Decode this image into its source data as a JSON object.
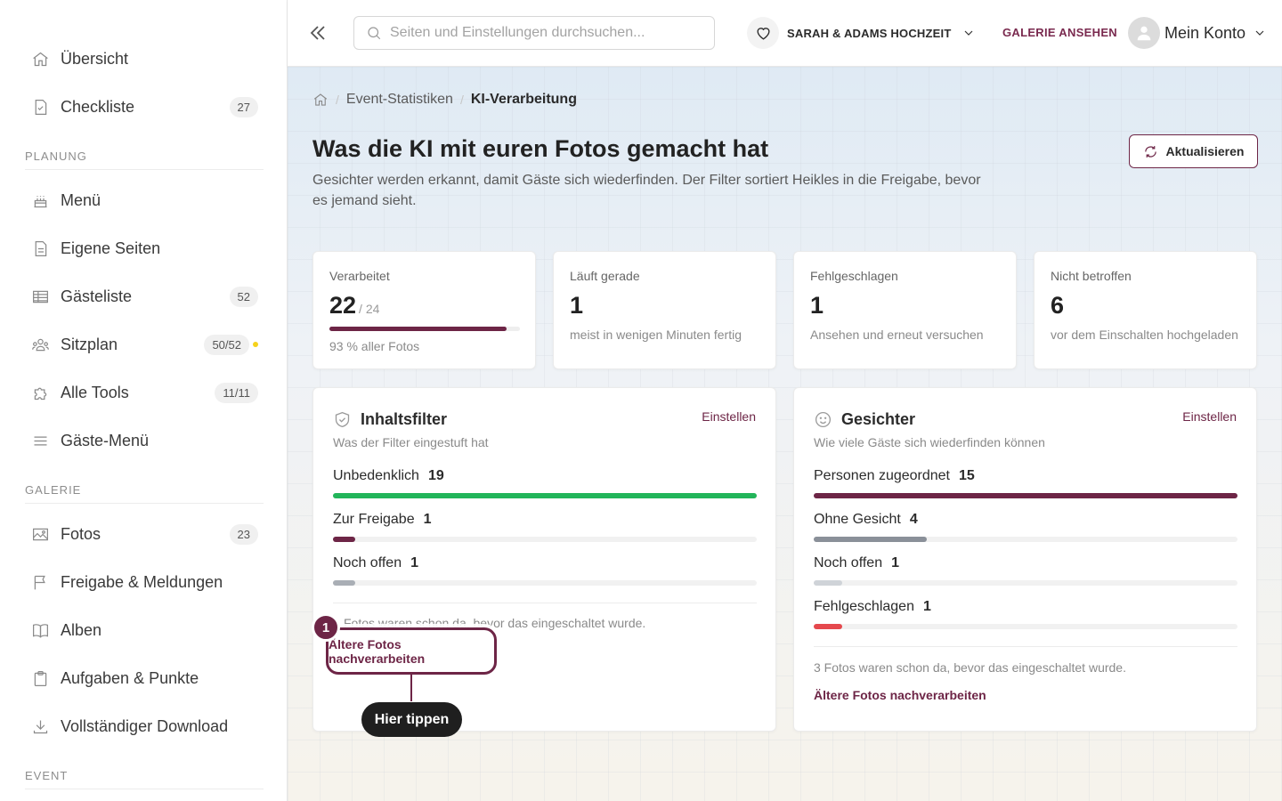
{
  "sidebar": {
    "items": [
      {
        "label": "Übersicht",
        "icon": "home-icon"
      },
      {
        "label": "Checkliste",
        "icon": "checklist-icon",
        "badge": "27"
      },
      {
        "label": "Menü",
        "icon": "cake-icon"
      },
      {
        "label": "Eigene Seiten",
        "icon": "page-icon"
      },
      {
        "label": "Gästeliste",
        "icon": "table-icon",
        "badge": "52"
      },
      {
        "label": "Sitzplan",
        "icon": "people-icon",
        "badge": "50/52"
      },
      {
        "label": "Alle Tools",
        "icon": "puzzle-icon",
        "badge": "11/11"
      },
      {
        "label": "Gäste-Menü",
        "icon": "menu-icon"
      },
      {
        "label": "Fotos",
        "icon": "image-icon",
        "badge": "23"
      },
      {
        "label": "Freigabe & Meldungen",
        "icon": "flag-icon"
      },
      {
        "label": "Alben",
        "icon": "book-icon"
      },
      {
        "label": "Aufgaben & Punkte",
        "icon": "clipboard-icon"
      },
      {
        "label": "Vollständiger Download",
        "icon": "download-icon"
      }
    ],
    "sections": {
      "planung": "PLANUNG",
      "galerie": "GALERIE",
      "event": "EVENT"
    },
    "status_dot_color": "#f5d21c"
  },
  "topbar": {
    "search_placeholder": "Seiten und Einstellungen durchsuchen...",
    "event_name": "SARAH & ADAMS HOCHZEIT",
    "view_gallery": "GALERIE ANSEHEN",
    "account": "Mein Konto"
  },
  "breadcrumb": {
    "items": [
      "Event-Statistiken",
      "KI-Verarbeitung"
    ]
  },
  "page": {
    "title": "Was die KI mit euren Fotos gemacht hat",
    "description": "Gesichter werden erkannt, damit Gäste sich wiederfinden. Der Filter sortiert Heikles in die Freigabe, bevor es jemand sieht.",
    "refresh": "Aktualisieren"
  },
  "stats": [
    {
      "label": "Verarbeitet",
      "value": "22",
      "total": "/ 24",
      "sub": "93 % aller Fotos",
      "progress": 0.93
    },
    {
      "label": "Läuft gerade",
      "value": "1",
      "sub": "meist in wenigen Minuten fertig"
    },
    {
      "label": "Fehlgeschlagen",
      "value": "1",
      "sub": "Ansehen und erneut versuchen"
    },
    {
      "label": "Nicht betroffen",
      "value": "6",
      "sub": "vor dem Einschalten hochgeladen"
    }
  ],
  "content_filter": {
    "title": "Inhaltsfilter",
    "subtitle": "Was der Filter eingestuft hat",
    "link": "Einstellen",
    "metrics": [
      {
        "label": "Unbedenklich",
        "value": "19",
        "fraction": 1.0,
        "color": "#22b55a"
      },
      {
        "label": "Zur Freigabe",
        "value": "1",
        "fraction": 0.053,
        "color": "#6d2546"
      },
      {
        "label": "Noch offen",
        "value": "1",
        "fraction": 0.053,
        "color": "#a9aeb5"
      }
    ],
    "note": "Fotos waren schon da, bevor das eingeschaltet wurde.",
    "action": "Ältere Fotos nachverarbeiten"
  },
  "faces": {
    "title": "Gesichter",
    "subtitle": "Wie viele Gäste sich wiederfinden können",
    "link": "Einstellen",
    "metrics": [
      {
        "label": "Personen zugeordnet",
        "value": "15",
        "fraction": 1.0,
        "color": "#6d2546"
      },
      {
        "label": "Ohne Gesicht",
        "value": "4",
        "fraction": 0.267,
        "color": "#8a9099"
      },
      {
        "label": "Noch offen",
        "value": "1",
        "fraction": 0.067,
        "color": "#cfd3d8"
      },
      {
        "label": "Fehlgeschlagen",
        "value": "1",
        "fraction": 0.067,
        "color": "#e5484d"
      }
    ],
    "note": "3 Fotos waren schon da, bevor das eingeschaltet wurde.",
    "action": "Ältere Fotos nachverarbeiten"
  },
  "tutorial": {
    "step": "1",
    "highlight_label": "Ältere Fotos nachverarbeiten",
    "hint": "Hier tippen"
  },
  "colors": {
    "brand": "#6d2546",
    "success": "#22b55a",
    "danger": "#e5484d"
  }
}
